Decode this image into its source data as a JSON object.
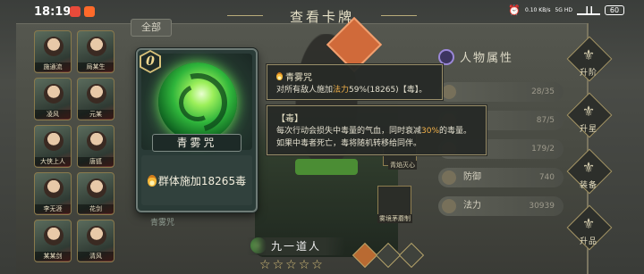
{
  "status_bar": {
    "time": "18:19",
    "network_speed": "0.10 KB/s",
    "network_type": "5G HD",
    "battery": "60"
  },
  "header": {
    "title": "查看卡牌",
    "tab_all": "全部"
  },
  "left_heroes": [
    "施通流",
    "局某生",
    "凌风",
    "元某",
    "大侠上人",
    "唐狐",
    "李无涯",
    "花剑",
    "某某剑",
    "清风"
  ],
  "card": {
    "cost": "0",
    "name": "青雾咒",
    "description": "群体施加18265毒",
    "caption": "青雾咒"
  },
  "character": {
    "name": "九一道人",
    "stars": [
      "☆",
      "☆",
      "☆",
      "☆",
      "☆"
    ]
  },
  "tooltip_skill": {
    "title": "青雾咒",
    "line_pre": "对所有敌人施加",
    "line_hl": "法力",
    "line_post": "59%(18265)【毒】。"
  },
  "tooltip_status": {
    "title": "【毒】",
    "line1_pre": "每次行动会损失中毒量的气血，同时衰减",
    "line1_hl": "30%",
    "line1_post": "的毒量。",
    "line2": "如果中毒者死亡，毒将随机转移给同伴。"
  },
  "attributes": {
    "title": "人物属性",
    "rows": [
      {
        "label": "",
        "value": "28/35"
      },
      {
        "label": "",
        "value": "87/5"
      },
      {
        "label": "",
        "value": "179/2"
      },
      {
        "label": "防御",
        "value": "740"
      },
      {
        "label": "法力",
        "value": "30939"
      }
    ]
  },
  "skills": {
    "cap1": "青焰灭心",
    "cap2": "雾境茅蘑制"
  },
  "side_menu": [
    "升阶",
    "升星",
    "装备",
    "升品"
  ]
}
